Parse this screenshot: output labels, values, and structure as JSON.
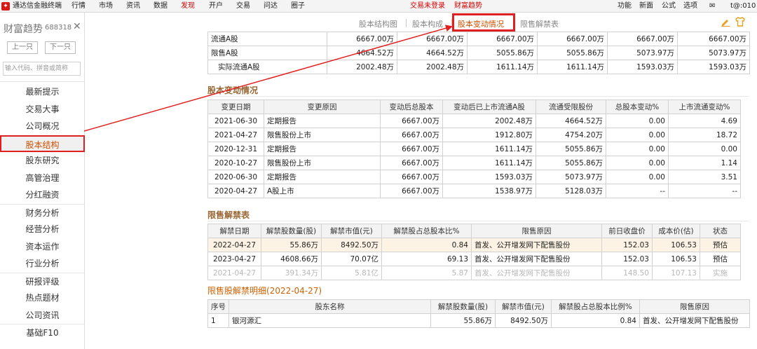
{
  "menubar": {
    "app_name": "通达信金融终端",
    "items": [
      "行情",
      "市场",
      "资讯",
      "数据",
      "发现",
      "开户",
      "交易",
      "问达",
      "圈子"
    ],
    "active_index": 4,
    "status_not_logged": "交易未登录",
    "status_title": "财富趋势",
    "right_items": [
      "功能",
      "新面",
      "公式",
      "选项"
    ],
    "server": "t@:010"
  },
  "sidebar": {
    "title": "财富趋势",
    "code": "688318",
    "prev_label": "上一只",
    "next_label": "下一只",
    "search_placeholder": "输入代码、拼音或简称",
    "items": [
      "最新提示",
      "交易大事",
      "公司概况",
      "股本结构",
      "股东研究",
      "高管治理",
      "分红融资",
      "财务分析",
      "经营分析",
      "资本运作",
      "行业分析",
      "研报评级",
      "热点题材",
      "公司资讯",
      "基础F10"
    ],
    "active_index": 3
  },
  "tabs": {
    "items": [
      "股本结构图",
      "股本构成",
      "股本变动情况",
      "限售解禁表"
    ],
    "active_index": 2
  },
  "share_structure": {
    "rows": [
      {
        "label": "流通A股",
        "values": [
          "6667.00万",
          "6667.00万",
          "6667.00万",
          "6667.00万",
          "6667.00万",
          "6667.00万"
        ]
      },
      {
        "label": "限售A股",
        "values": [
          "4664.52万",
          "4664.52万",
          "5055.86万",
          "5055.86万",
          "5073.97万",
          "5073.97万"
        ]
      },
      {
        "label": "实际流通A股",
        "values": [
          "2002.48万",
          "2002.48万",
          "1611.14万",
          "1611.14万",
          "1593.03万",
          "1593.03万"
        ]
      }
    ]
  },
  "changes": {
    "title": "股本变动情况",
    "headers": [
      "变更日期",
      "变更原因",
      "变动后总股本",
      "变动后已上市流通A股",
      "流通受限股份",
      "总股本变动%",
      "上市流通变动%"
    ],
    "rows": [
      [
        "2021-06-30",
        "定期报告",
        "6667.00万",
        "2002.48万",
        "4664.52万",
        "0.00",
        "4.69"
      ],
      [
        "2021-04-27",
        "限售股份上市",
        "6667.00万",
        "1912.80万",
        "4754.20万",
        "0.00",
        "18.72"
      ],
      [
        "2020-12-31",
        "定期报告",
        "6667.00万",
        "1611.14万",
        "5055.86万",
        "0.00",
        "0.00"
      ],
      [
        "2020-10-27",
        "限售股份上市",
        "6667.00万",
        "1611.14万",
        "5055.86万",
        "0.00",
        "1.14"
      ],
      [
        "2020-06-30",
        "定期报告",
        "6667.00万",
        "1593.03万",
        "5073.97万",
        "0.00",
        "3.51"
      ],
      [
        "2020-04-27",
        "A股上市",
        "6667.00万",
        "1538.97万",
        "5128.03万",
        "--",
        "--"
      ]
    ]
  },
  "unlock": {
    "title": "限售解禁表",
    "headers": [
      "解禁日期",
      "解禁股数量(股)",
      "解禁市值(元)",
      "解禁股占总股本比%",
      "限售原因",
      "前日收盘价",
      "成本价(估)",
      "状态"
    ],
    "rows": [
      [
        "2022-04-27",
        "55.86万",
        "8492.50万",
        "0.84",
        "首发、公开增发网下配售股份",
        "152.03",
        "106.53",
        "预估"
      ],
      [
        "2023-04-27",
        "4608.66万",
        "70.07亿",
        "69.13",
        "首发、公开增发网下配售股份",
        "152.03",
        "106.53",
        "预估"
      ],
      [
        "2021-04-27",
        "391.34万",
        "5.81亿",
        "5.87",
        "首发、公开增发网下配售股份",
        "148.50",
        "107.13",
        "实施"
      ]
    ]
  },
  "detail": {
    "title": "限售股解禁明细(2022-04-27)",
    "headers": [
      "序号",
      "股东名称",
      "解禁股数量(股)",
      "解禁市值(元)",
      "解禁股占总股本比例%",
      "限售原因"
    ],
    "rows": [
      [
        "1",
        "银河源汇",
        "55.86万",
        "8492.50万",
        "0.84",
        "首发、公开增发网下配售股份"
      ]
    ]
  },
  "colors": {
    "annotation_red": "#e02020",
    "active_orange": "#d05000",
    "section_brown": "#996633"
  }
}
